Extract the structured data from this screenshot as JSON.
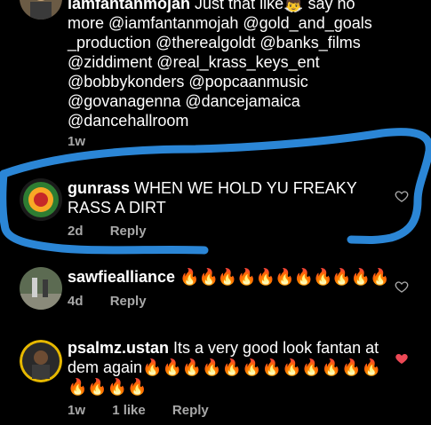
{
  "comments": [
    {
      "username": "iamfantanmojah",
      "text": "Just that like👼 say no more @iamfantanmojah @gold_and_goals _production @therealgoldt @banks_films @ziddiment @real_krass_keys_ent @bobbykonders @popcaanmusic @govanagenna @dancejamaica @dancehallroom",
      "time": "1w"
    },
    {
      "username": "gunrass",
      "text": "WHEN WE HOLD YU FREAKY RASS A DIRT",
      "time": "2d",
      "reply": "Reply",
      "liked": false
    },
    {
      "username": "sawfiealliance",
      "text": "🔥🔥🔥🔥🔥🔥🔥🔥🔥🔥🔥",
      "time": "4d",
      "reply": "Reply",
      "liked": false
    },
    {
      "username": "psalmz.ustan",
      "text": "Its a very good look fantan at dem again🔥🔥🔥🔥🔥🔥🔥🔥🔥🔥🔥🔥🔥🔥🔥🔥",
      "time": "1w",
      "likes": "1 like",
      "reply": "Reply",
      "liked": true
    }
  ],
  "colors": {
    "background": "#000000",
    "meta": "#a8a8a8",
    "heart_liked": "#ed4956",
    "annotation": "#2b86d6"
  },
  "icons": {
    "heart": "heart-icon",
    "heart_filled": "heart-filled-icon"
  }
}
